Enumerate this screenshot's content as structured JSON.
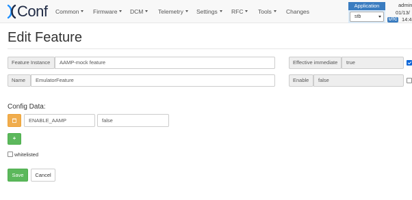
{
  "app": {
    "logo_text": "Conf"
  },
  "nav": {
    "items": [
      {
        "label": "Common",
        "has_caret": true
      },
      {
        "label": "Firmware",
        "has_caret": true
      },
      {
        "label": "DCM",
        "has_caret": true
      },
      {
        "label": "Telemetry",
        "has_caret": true
      },
      {
        "label": "Settings",
        "has_caret": true
      },
      {
        "label": "RFC",
        "has_caret": true
      },
      {
        "label": "Tools",
        "has_caret": true
      },
      {
        "label": "Changes",
        "has_caret": false
      }
    ],
    "application_label": "Application",
    "application_value": "stb",
    "user": "admin",
    "date": "01/13/",
    "utc_badge": "UTC",
    "time": "14:4"
  },
  "page": {
    "title": "Edit Feature",
    "feature_instance_label": "Feature Instance",
    "feature_instance_value": "AAMP-mock feature",
    "name_label": "Name",
    "name_value": "EmulatorFeature",
    "effective_immediate_label": "Effective immediate",
    "effective_immediate_value": "true",
    "effective_immediate_checked": true,
    "enable_label": "Enable",
    "enable_value": "false",
    "enable_checked": false,
    "config_data_label": "Config Data:",
    "config_rows": [
      {
        "key": "ENABLE_AAMP",
        "value": "false"
      }
    ],
    "add_label": "+",
    "whitelisted_label": "whitelisted",
    "whitelisted_checked": false,
    "save_label": "Save",
    "cancel_label": "Cancel"
  },
  "colors": {
    "primary": "#3a7cc0",
    "success": "#5cb85c",
    "warning": "#f0ad4e",
    "checkbox_checked": "#0a66d8"
  },
  "icons": {
    "delete": "trash-icon",
    "logo": "xconf-logo-icon"
  }
}
